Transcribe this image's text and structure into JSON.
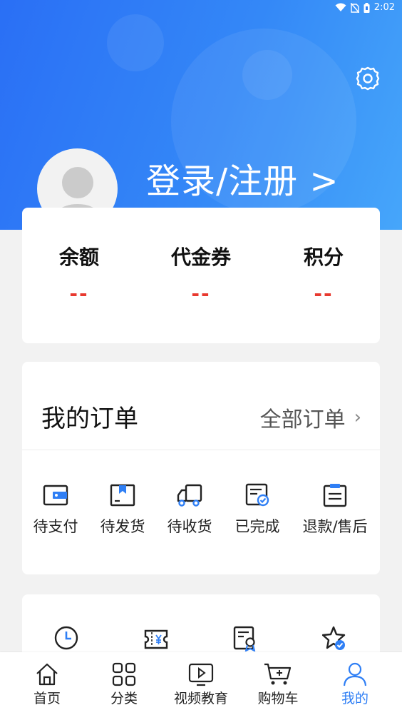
{
  "status_bar": {
    "time": "2:02"
  },
  "profile": {
    "login_text": "登录/注册 >"
  },
  "balance": {
    "items": [
      {
        "label": "余额",
        "value": "--"
      },
      {
        "label": "代金券",
        "value": "--"
      },
      {
        "label": "积分",
        "value": "--"
      }
    ]
  },
  "orders": {
    "title": "我的订单",
    "all_label": "全部订单",
    "items": [
      {
        "label": "待支付",
        "icon": "wallet-icon"
      },
      {
        "label": "待发货",
        "icon": "package-icon"
      },
      {
        "label": "待收货",
        "icon": "truck-icon"
      },
      {
        "label": "已完成",
        "icon": "completed-doc-icon"
      },
      {
        "label": "退款/售后",
        "icon": "refund-clipboard-icon"
      }
    ]
  },
  "tools": {
    "icons": [
      "history-clock-icon",
      "coupon-yen-icon",
      "certificate-icon",
      "favorite-star-icon"
    ]
  },
  "tabbar": {
    "items": [
      {
        "label": "首页",
        "icon": "home-icon"
      },
      {
        "label": "分类",
        "icon": "category-grid-icon"
      },
      {
        "label": "视频教育",
        "icon": "video-play-icon"
      },
      {
        "label": "购物车",
        "icon": "cart-icon"
      },
      {
        "label": "我的",
        "icon": "user-icon"
      }
    ],
    "active": "我的"
  },
  "colors": {
    "accent": "#2f7ff5",
    "header_start": "#2a6ff5",
    "header_end": "#46a6fa",
    "value_red": "#e8392f"
  }
}
